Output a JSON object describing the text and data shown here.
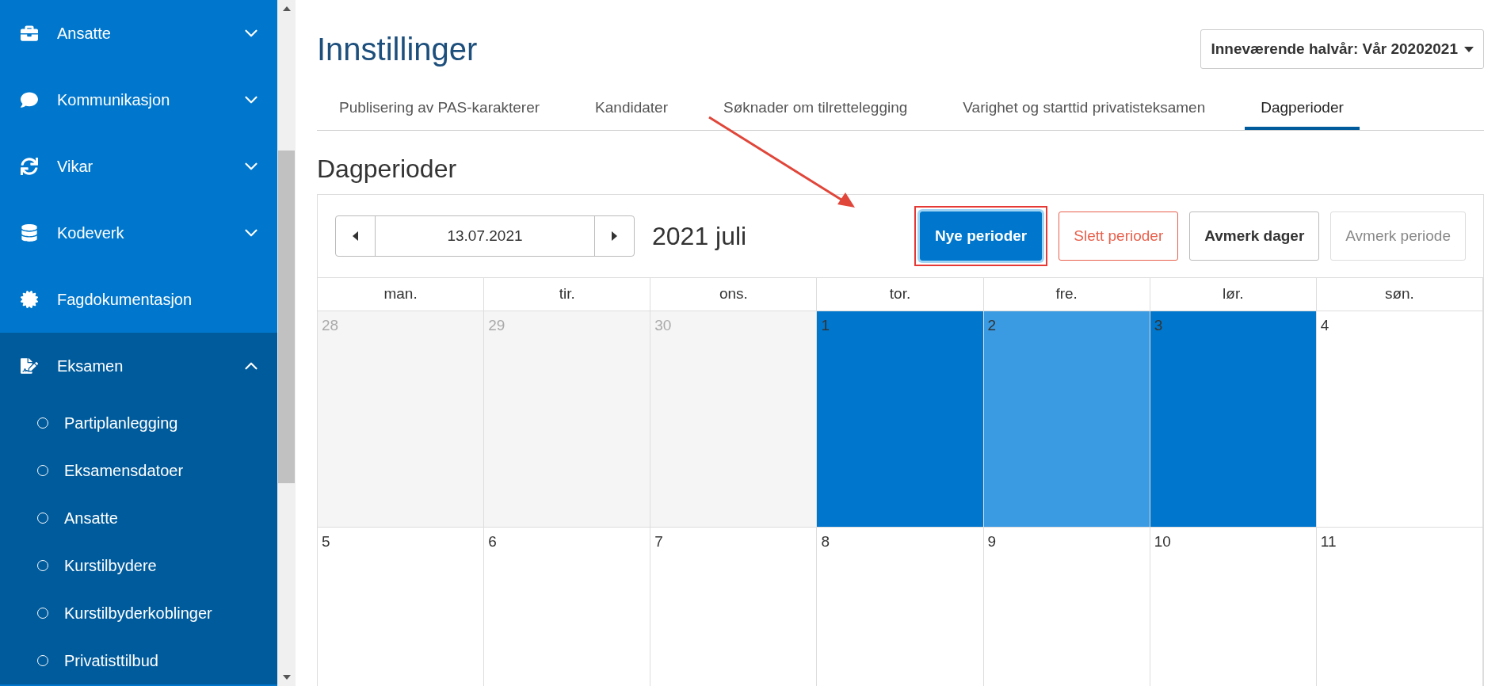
{
  "sidebar": {
    "items": [
      {
        "label": "Ansatte",
        "expanded": false
      },
      {
        "label": "Kommunikasjon",
        "expanded": false
      },
      {
        "label": "Vikar",
        "expanded": false
      },
      {
        "label": "Kodeverk",
        "expanded": false
      },
      {
        "label": "Fagdokumentasjon"
      },
      {
        "label": "Eksamen",
        "expanded": true,
        "children": [
          {
            "label": "Partiplanlegging"
          },
          {
            "label": "Eksamensdatoer"
          },
          {
            "label": "Ansatte"
          },
          {
            "label": "Kurstilbydere"
          },
          {
            "label": "Kurstilbyderkoblinger"
          },
          {
            "label": "Privatisttilbud"
          }
        ]
      }
    ]
  },
  "page": {
    "title": "Innstillinger",
    "term_select": {
      "value": "Inneværende halvår: Vår 20202021"
    }
  },
  "tabs": [
    {
      "label": "Publisering av PAS-karakterer",
      "selected": false
    },
    {
      "label": "Kandidater",
      "selected": false
    },
    {
      "label": "Søknader om tilrettelegging",
      "selected": false
    },
    {
      "label": "Varighet og starttid privatisteksamen",
      "selected": false
    },
    {
      "label": "Dagperioder",
      "selected": true
    }
  ],
  "section_title": "Dagperioder",
  "calendar": {
    "date_field": {
      "value": "13.07.2021"
    },
    "month_label": "2021 juli",
    "buttons": [
      {
        "label": "Nye perioder",
        "kind": "primary",
        "disabled": false,
        "highlighted": true
      },
      {
        "label": "Slett perioder",
        "kind": "danger",
        "disabled": false,
        "highlighted": false
      },
      {
        "label": "Avmerk dager",
        "kind": "default",
        "disabled": false,
        "highlighted": false
      },
      {
        "label": "Avmerk periode",
        "kind": "default",
        "disabled": true,
        "highlighted": false
      }
    ],
    "weekdays": [
      "man.",
      "tir.",
      "ons.",
      "tor.",
      "fre.",
      "lør.",
      "søn."
    ],
    "weeks": [
      [
        {
          "day": "28",
          "kind": "outside"
        },
        {
          "day": "29",
          "kind": "outside"
        },
        {
          "day": "30",
          "kind": "outside"
        },
        {
          "day": "1",
          "kind": "period"
        },
        {
          "day": "2",
          "kind": "period_light"
        },
        {
          "day": "3",
          "kind": "period"
        },
        {
          "day": "4",
          "kind": "normal"
        }
      ],
      [
        {
          "day": "5",
          "kind": "normal"
        },
        {
          "day": "6",
          "kind": "normal"
        },
        {
          "day": "7",
          "kind": "normal"
        },
        {
          "day": "8",
          "kind": "normal"
        },
        {
          "day": "9",
          "kind": "normal"
        },
        {
          "day": "10",
          "kind": "normal"
        },
        {
          "day": "11",
          "kind": "normal"
        }
      ]
    ]
  }
}
